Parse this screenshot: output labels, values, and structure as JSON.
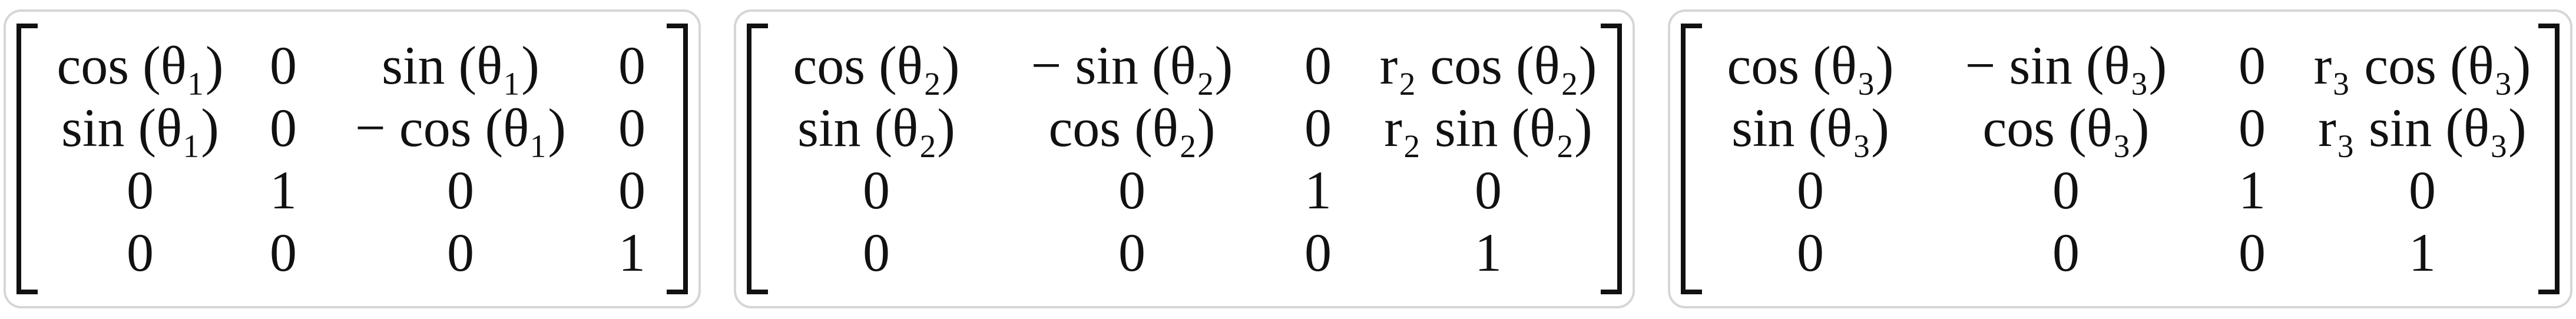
{
  "matrices": [
    {
      "rows": [
        [
          "cos (θ₁)",
          "0",
          "sin (θ₁)",
          "0"
        ],
        [
          "sin (θ₁)",
          "0",
          "− cos (θ₁)",
          "0"
        ],
        [
          "0",
          "1",
          "0",
          "0"
        ],
        [
          "0",
          "0",
          "0",
          "1"
        ]
      ]
    },
    {
      "rows": [
        [
          "cos (θ₂)",
          "− sin (θ₂)",
          "0",
          "r₂ cos (θ₂)"
        ],
        [
          "sin (θ₂)",
          "cos (θ₂)",
          "0",
          "r₂ sin (θ₂)"
        ],
        [
          "0",
          "0",
          "1",
          "0"
        ],
        [
          "0",
          "0",
          "0",
          "1"
        ]
      ]
    },
    {
      "rows": [
        [
          "cos (θ₃)",
          "− sin (θ₃)",
          "0",
          "r₃ cos (θ₃)"
        ],
        [
          "sin (θ₃)",
          "cos (θ₃)",
          "0",
          "r₃ sin (θ₃)"
        ],
        [
          "0",
          "0",
          "1",
          "0"
        ],
        [
          "0",
          "0",
          "0",
          "1"
        ]
      ]
    }
  ]
}
